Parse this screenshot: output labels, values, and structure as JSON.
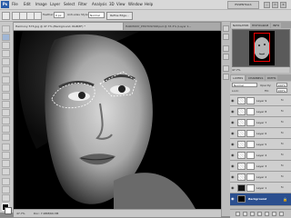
{
  "app": {
    "logo": "Ps"
  },
  "menu": [
    "File",
    "Edit",
    "Image",
    "Layer",
    "Select",
    "Filter",
    "Analysis",
    "3D",
    "View",
    "Window",
    "Help"
  ],
  "workspace": {
    "label": "ESSENTIALS"
  },
  "window_buttons": [
    "–",
    "▭",
    "✕"
  ],
  "options": {
    "feather_label": "Feather:",
    "feather_value": "0 px",
    "antialias_label": "Anti-alias",
    "style_label": "Style:",
    "style_value": "Normal",
    "refine_edge": "Refine Edge..."
  },
  "document": {
    "tab1": "Harmony 573.jpg @ 47.7% (Background, RGB/8*) *",
    "tab2": "HARMONY_PHOTOSHOP.psd @ 33.3% (Layer 1...",
    "status_zoom": "47.7%",
    "status_doc": "Doc: 7.48M/60.3M"
  },
  "panels": {
    "navigator_tabs": [
      "NAVIGATOR",
      "HISTOGRAM",
      "INFO"
    ],
    "zoom": "47.7%",
    "layers_tabs": [
      "LAYERS",
      "CHANNELS",
      "PATHS"
    ],
    "blend_mode": "Normal",
    "opacity_label": "Opacity:",
    "opacity_value": "100%",
    "lock_label": "Lock:",
    "fill_label": "Fill:",
    "fill_value": "100%",
    "layers": [
      {
        "name": "Layer 9",
        "fx": "fx"
      },
      {
        "name": "Layer 8",
        "fx": "fx"
      },
      {
        "name": "Layer 7",
        "fx": "fx"
      },
      {
        "name": "Layer 6",
        "fx": "fx"
      },
      {
        "name": "Layer 5",
        "fx": "fx"
      },
      {
        "name": "Layer 4",
        "fx": "fx"
      },
      {
        "name": "Layer 3",
        "fx": "fx"
      },
      {
        "name": "Layer 2",
        "fx": "fx"
      },
      {
        "name": "Layer 1",
        "fx": "fx"
      },
      {
        "name": "Background",
        "fx": ""
      }
    ]
  },
  "colors": {
    "accent": "#2b4f8f",
    "selection_row": "#2b4f8f",
    "nav_view_box": "#e00000"
  }
}
